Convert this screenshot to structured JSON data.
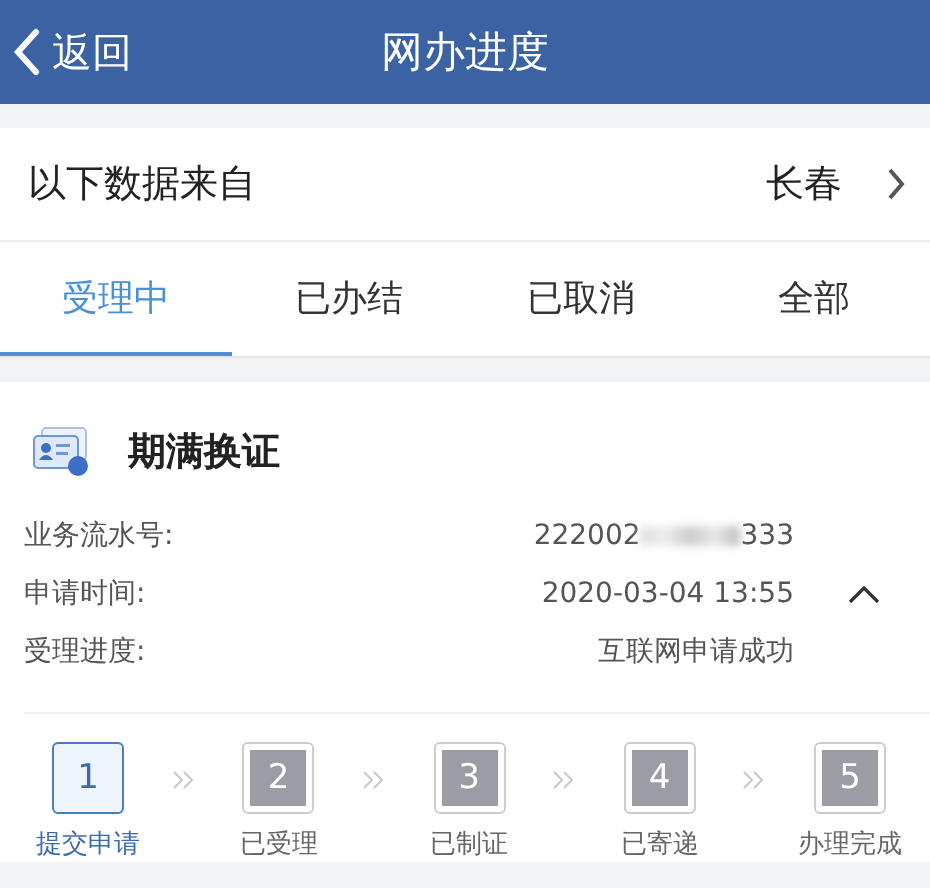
{
  "header": {
    "back": "返回",
    "title": "网办进度"
  },
  "source": {
    "label": "以下数据来自",
    "city": "长春"
  },
  "tabs": [
    {
      "label": "受理中",
      "selected": true
    },
    {
      "label": "已办结",
      "selected": false
    },
    {
      "label": "已取消",
      "selected": false
    },
    {
      "label": "全部",
      "selected": false
    }
  ],
  "card": {
    "title": "期满换证",
    "expanded": true,
    "fields": [
      {
        "label": "业务流水号:",
        "kind": "masked",
        "value_start": "222002",
        "value_end": "333"
      },
      {
        "label": "申请时间:",
        "kind": "plain",
        "value": "2020-03-04 13:55"
      },
      {
        "label": "受理进度:",
        "kind": "plain",
        "value": "互联网申请成功"
      }
    ],
    "steps": [
      {
        "number": "1",
        "label": "提交申请",
        "selected": true
      },
      {
        "number": "2",
        "label": "已受理",
        "selected": false
      },
      {
        "number": "3",
        "label": "已制证",
        "selected": false
      },
      {
        "number": "4",
        "label": "已寄递",
        "selected": false
      },
      {
        "number": "5",
        "label": "办理完成",
        "selected": false
      }
    ]
  }
}
